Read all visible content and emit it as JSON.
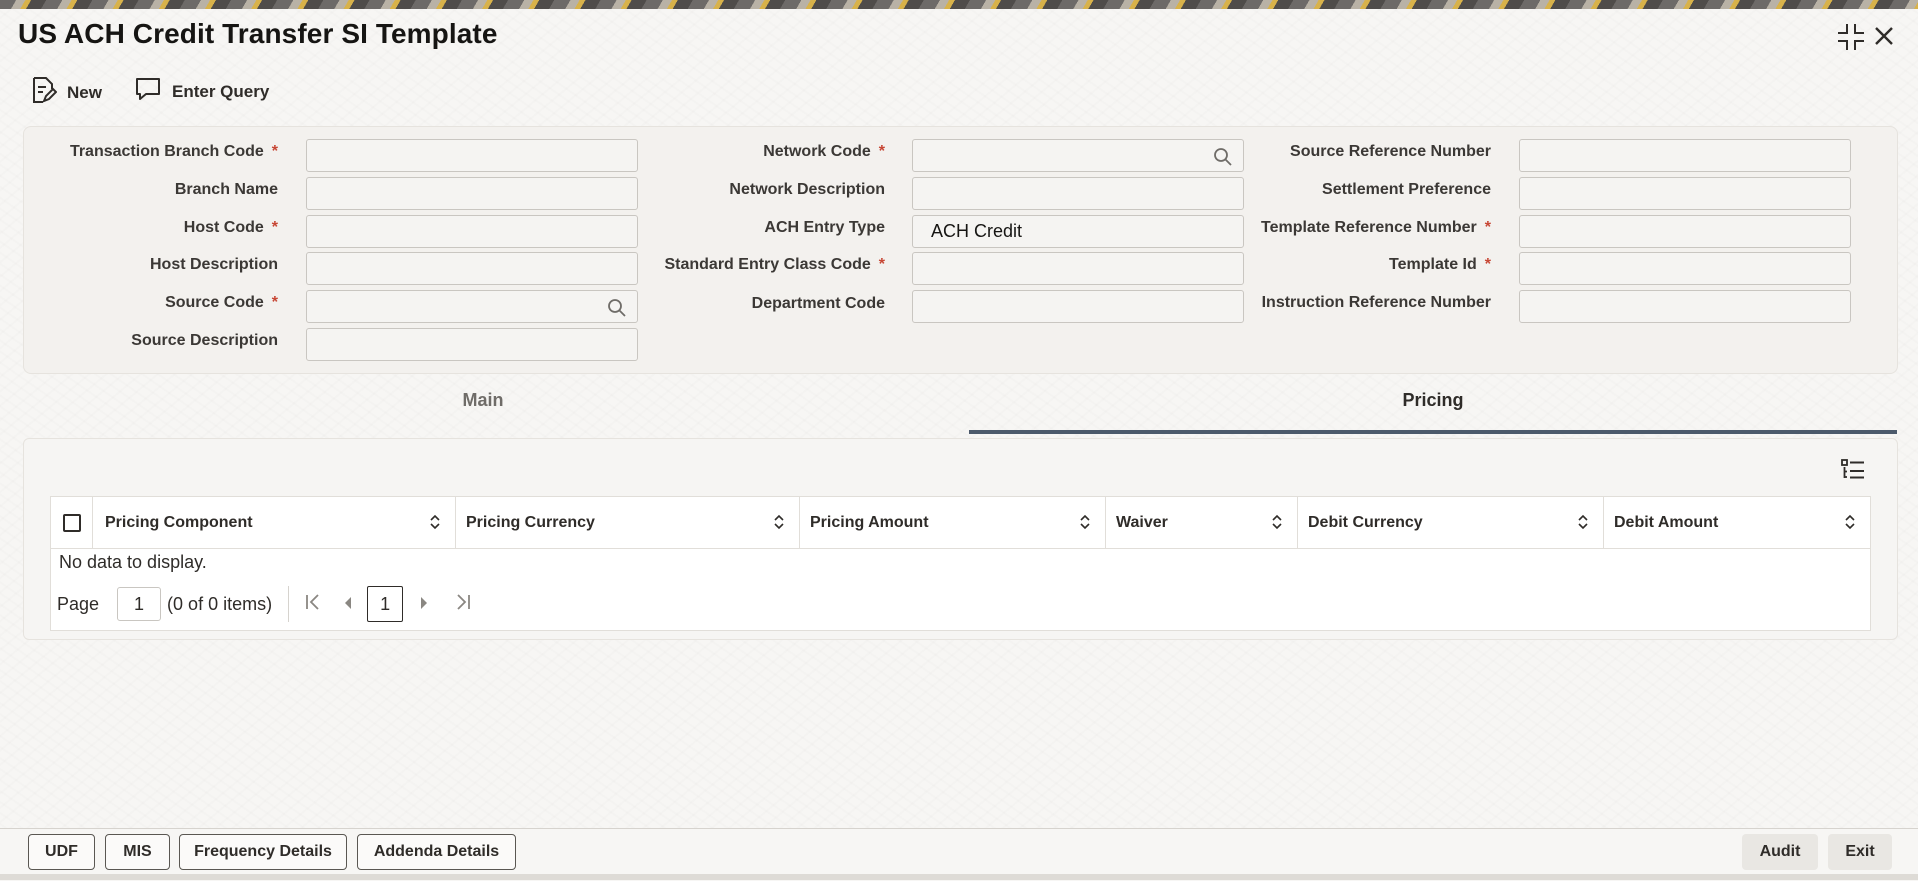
{
  "window": {
    "title": "US ACH Credit Transfer SI Template",
    "controls": [
      "collapse-icon",
      "close-icon"
    ]
  },
  "toolbar": {
    "new_label": "New",
    "enter_query_label": "Enter Query"
  },
  "form": {
    "col1": [
      {
        "label": "Transaction Branch Code",
        "required": "*",
        "value": ""
      },
      {
        "label": "Branch Name",
        "value": ""
      },
      {
        "label": "Host Code",
        "required": "*",
        "value": ""
      },
      {
        "label": "Host Description",
        "value": ""
      },
      {
        "label": "Source Code",
        "required": "*",
        "value": ""
      },
      {
        "label": "Source Description",
        "value": ""
      }
    ],
    "col2": [
      {
        "label": "Network Code",
        "required": "*",
        "value": ""
      },
      {
        "label": "Network Description",
        "value": ""
      },
      {
        "label": "ACH Entry Type",
        "value": "ACH Credit"
      },
      {
        "label": "Standard Entry Class Code",
        "required": "*",
        "value": ""
      },
      {
        "label": "Department Code",
        "value": ""
      }
    ],
    "col3": [
      {
        "label": "Source Reference Number",
        "value": ""
      },
      {
        "label": "Settlement Preference",
        "value": ""
      },
      {
        "label": "Template Reference Number",
        "required": "*",
        "value": ""
      },
      {
        "label": "Template Id",
        "required": "*",
        "value": ""
      },
      {
        "label": "Instruction Reference Number",
        "value": ""
      }
    ]
  },
  "tabs": [
    {
      "label": "Main",
      "active": false
    },
    {
      "label": "Pricing",
      "active": true
    }
  ],
  "pricing_table": {
    "columns": [
      "Pricing Component",
      "Pricing Currency",
      "Pricing Amount",
      "Waiver",
      "Debit Currency",
      "Debit Amount"
    ],
    "empty_text": "No data to display.",
    "pager": {
      "page_label": "Page",
      "page_value": "1",
      "items_text": "(0 of 0 items)",
      "current_page": "1"
    }
  },
  "footer": {
    "left_buttons": [
      "UDF",
      "MIS",
      "Frequency Details",
      "Addenda Details"
    ],
    "right_buttons": [
      "Audit",
      "Exit"
    ]
  },
  "colors": {
    "required": "#c74634",
    "active_tab_underline": "#4c5a6b"
  }
}
